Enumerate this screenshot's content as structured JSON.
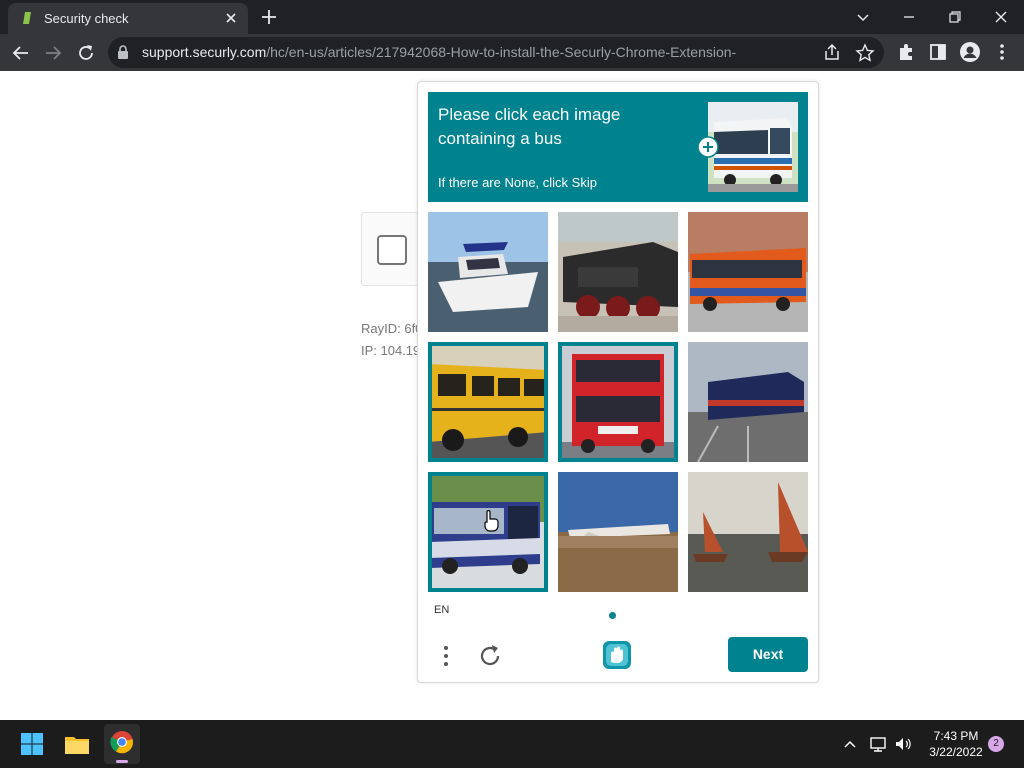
{
  "browser": {
    "tab_title": "Security check",
    "url_host": "support.securly.com",
    "url_path": "/hc/en-us/articles/217942068-How-to-install-the-Securly-Chrome-Extension-"
  },
  "page": {
    "ray_id": "RayID: 6f0",
    "ip": "IP: 104.19"
  },
  "captcha": {
    "prompt": "Please click each image containing a bus",
    "sub": "If there are None, click Skip",
    "lang": "EN",
    "next_label": "Next",
    "accent": "#00838f",
    "tiles": [
      {
        "subject": "boat",
        "selected": false
      },
      {
        "subject": "steam train",
        "selected": false
      },
      {
        "subject": "orange bus",
        "selected": false
      },
      {
        "subject": "yellow school bus",
        "selected": true
      },
      {
        "subject": "red double-decker bus",
        "selected": true
      },
      {
        "subject": "blue train",
        "selected": false
      },
      {
        "subject": "blue bus",
        "selected": true
      },
      {
        "subject": "airplane",
        "selected": false
      },
      {
        "subject": "sailboats",
        "selected": false
      }
    ]
  },
  "taskbar": {
    "time": "7:43 PM",
    "date": "3/22/2022",
    "notifications": "2"
  }
}
